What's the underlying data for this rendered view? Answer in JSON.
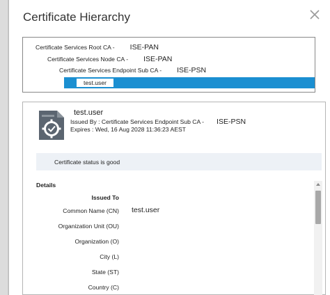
{
  "dialog": {
    "title": "Certificate Hierarchy",
    "close_icon": "close-icon"
  },
  "hierarchy": [
    {
      "label": "Certificate Services Root CA -",
      "server": "ISE-PAN"
    },
    {
      "label": "Certificate Services Node CA -",
      "server": "ISE-PAN"
    },
    {
      "label": "Certificate Services Endpoint Sub CA -",
      "server": "ISE-PSN"
    }
  ],
  "selected": {
    "label": "test.user"
  },
  "certificate": {
    "icon": "certificate-gear-icon",
    "name": "test.user",
    "issued_by_label": "Issued By : Certificate Services Endpoint Sub CA -",
    "issued_by_server": "ISE-PSN",
    "expires": "Expires : Wed, 16 Aug 2028 11:36:23 AEST"
  },
  "status": {
    "text": "Certificate status is good"
  },
  "details": {
    "heading": "Details",
    "section_issued_to": "Issued To",
    "fields": [
      {
        "label": "Common Name (CN)",
        "value": "test.user"
      },
      {
        "label": "Organization Unit (OU)",
        "value": ""
      },
      {
        "label": "Organization (O)",
        "value": ""
      },
      {
        "label": "City (L)",
        "value": ""
      },
      {
        "label": "State (ST)",
        "value": ""
      },
      {
        "label": "Country (C)",
        "value": ""
      }
    ]
  }
}
